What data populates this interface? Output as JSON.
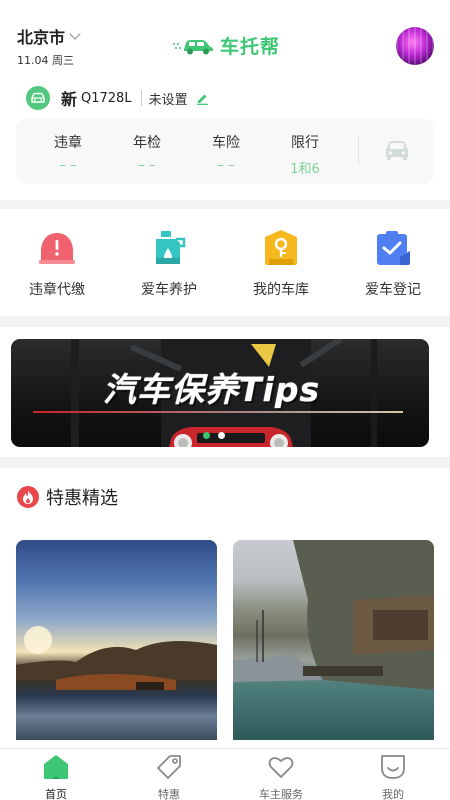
{
  "header": {
    "city": "北京市",
    "date": "11.04 周三",
    "logo_text": "车托帮"
  },
  "vehicle": {
    "plate_province": "新",
    "plate_number": "Q1728L",
    "status": "未设置"
  },
  "stats": [
    {
      "label": "违章",
      "value": "– –"
    },
    {
      "label": "年检",
      "value": "– –"
    },
    {
      "label": "车险",
      "value": "– –"
    },
    {
      "label": "限行",
      "value": "1和6"
    }
  ],
  "services": [
    {
      "label": "违章代缴",
      "icon": "alert-icon",
      "color": "#f0636e"
    },
    {
      "label": "爱车养护",
      "icon": "oil-can-icon",
      "color": "#35c6c3"
    },
    {
      "label": "我的车库",
      "icon": "garage-key-icon",
      "color": "#f6b81e"
    },
    {
      "label": "爱车登记",
      "icon": "clipboard-check-icon",
      "color": "#4f7ff2"
    }
  ],
  "banner": {
    "title": "汽车保养Tips",
    "active_slide": 1,
    "slide_count": 2
  },
  "specials": {
    "title": "特惠精选"
  },
  "tabs": [
    {
      "label": "首页",
      "icon": "home-icon",
      "active": true
    },
    {
      "label": "特惠",
      "icon": "tag-icon",
      "active": false
    },
    {
      "label": "车主服务",
      "icon": "heart-icon",
      "active": false
    },
    {
      "label": "我的",
      "icon": "profile-icon",
      "active": false
    }
  ],
  "colors": {
    "accent": "#3dc774",
    "stat_value": "#7ad39a",
    "divider_band": "#f3f3f3"
  }
}
